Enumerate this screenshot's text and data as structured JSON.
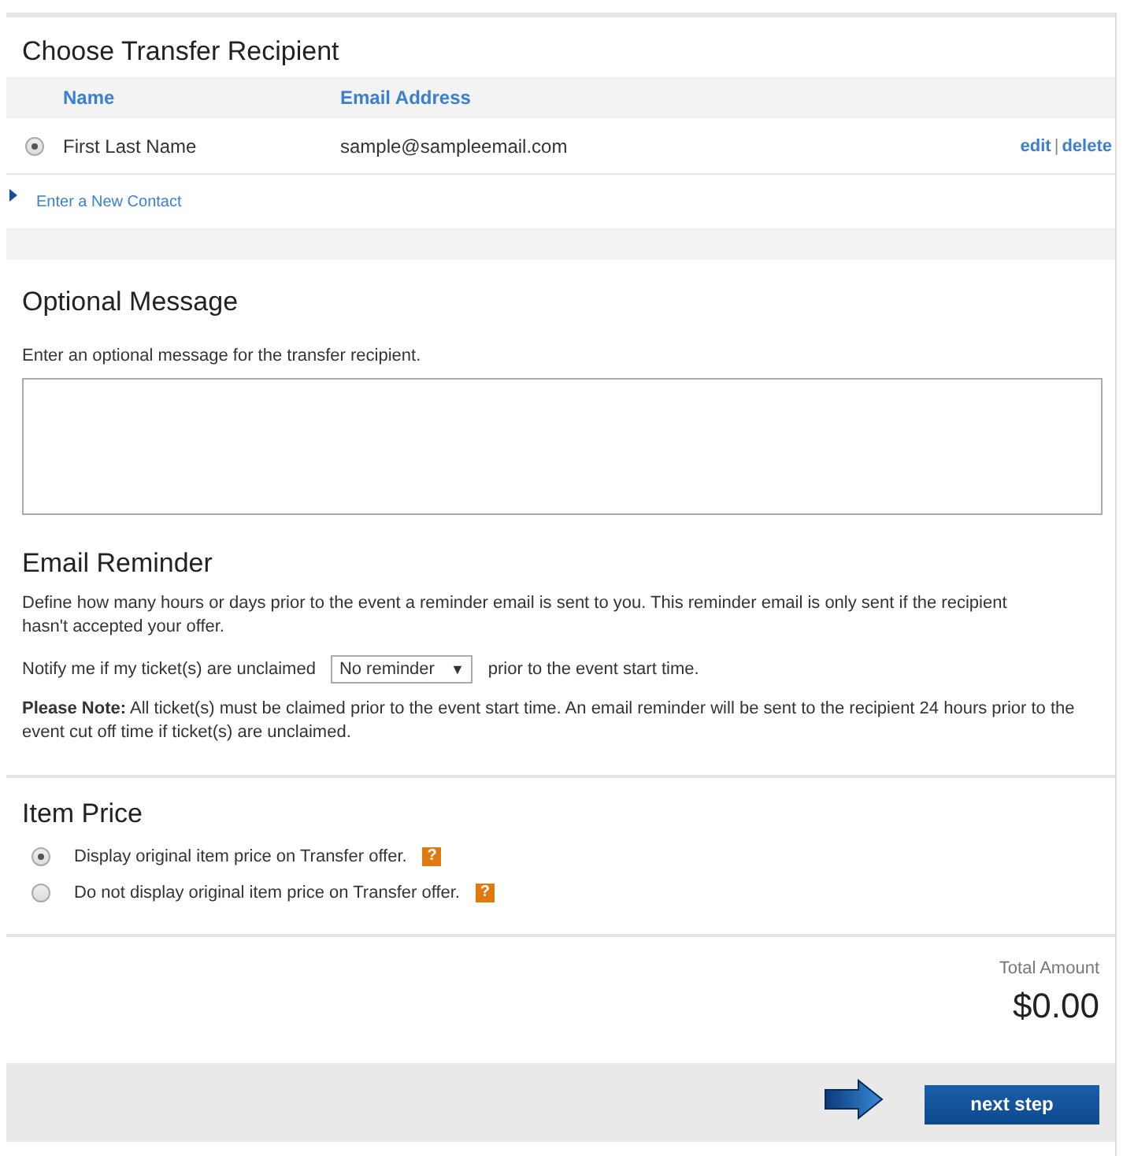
{
  "recipient": {
    "title": "Choose Transfer Recipient",
    "columns": [
      "Name",
      "Email Address"
    ],
    "contacts": [
      {
        "name": "First Last Name",
        "email": "sample@sampleemail.com",
        "selected": true,
        "edit": "edit",
        "separator": "|",
        "delete": "delete"
      }
    ],
    "new_contact": "Enter a New Contact"
  },
  "message": {
    "title": "Optional Message",
    "description": "Enter an optional message for the transfer recipient."
  },
  "reminder": {
    "title": "Email Reminder",
    "description": "Define how many hours or days prior to the event a reminder email is sent to you. This reminder email is only sent if the recipient hasn't accepted your offer.",
    "notify_label": "Notify me if my ticket(s) are unclaimed",
    "select_value": "No reminder",
    "select_arrow": "▼",
    "notify_suffix": "prior to the event start time.",
    "note": "**Please Note:** All ticket(s) must be claimed prior to the event start time. An email reminder will be sent to the recipient 24 hours prior to the event cut off time if ticket(s) are unclaimed."
  },
  "item_price": {
    "title": "Item Price",
    "options": [
      {
        "label": "Display original item price on Transfer offer.",
        "selected": true,
        "help": "?"
      },
      {
        "label": "Do not display original item price on Transfer offer.",
        "selected": false,
        "help": "?"
      }
    ]
  },
  "total": {
    "label": "Total Amount",
    "amount": "$0.00"
  },
  "footer": {
    "button": "next step"
  }
}
